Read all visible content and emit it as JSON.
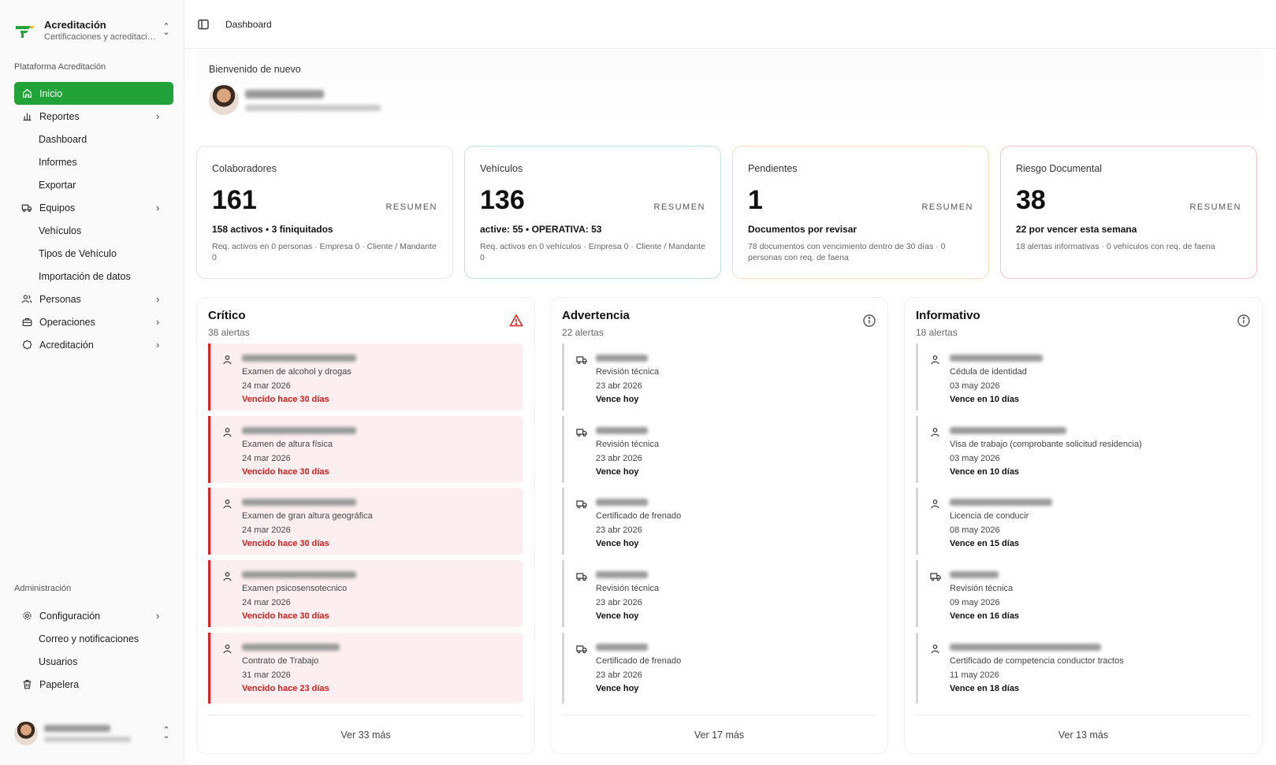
{
  "brand": {
    "title": "Acreditación",
    "subtitle": "Certificaciones y acreditaciones"
  },
  "sidebar": {
    "section_label": "Plataforma Acreditación",
    "items": [
      {
        "label": "Inicio",
        "icon": "home-icon",
        "active": true
      },
      {
        "label": "Reportes",
        "icon": "chart-icon",
        "subitems": [
          "Dashboard",
          "Informes",
          "Exportar"
        ]
      },
      {
        "label": "Equipos",
        "icon": "truck-icon",
        "subitems": [
          "Vehículos",
          "Tipos de Vehículo",
          "Importación de datos"
        ]
      },
      {
        "label": "Personas",
        "icon": "users-icon"
      },
      {
        "label": "Operaciones",
        "icon": "briefcase-icon"
      },
      {
        "label": "Acreditación",
        "icon": "badge-icon"
      }
    ],
    "admin_label": "Administración",
    "admin_items": [
      {
        "label": "Configuración",
        "icon": "gear-icon",
        "subitems": [
          "Correo y notificaciones",
          "Usuarios"
        ]
      },
      {
        "label": "Papelera",
        "icon": "trash-icon"
      }
    ]
  },
  "topbar": {
    "breadcrumb": "Dashboard"
  },
  "welcome": {
    "label": "Bienvenido de nuevo"
  },
  "stats": [
    {
      "title": "Colaboradores",
      "value": "161",
      "tag": "RESUMEN",
      "line1": "158 activos • 3 finiquitados",
      "line2": "Req. activos en 0 personas · Empresa 0 · Cliente / Mandante 0",
      "border": "#e6e6e6"
    },
    {
      "title": "Vehículos",
      "value": "136",
      "tag": "RESUMEN",
      "line1": "active: 55 • OPERATIVA: 53",
      "line2": "Req. activos en 0 vehículos · Empresa 0 · Cliente / Mandante 0",
      "border": "#bfe3de"
    },
    {
      "title": "Pendientes",
      "value": "1",
      "tag": "RESUMEN",
      "line1": "Documentos por revisar",
      "line2": "78 documentos con vencimiento dentro de 30 días · 0 personas con req. de faena",
      "border": "#f5dcc0"
    },
    {
      "title": "Riesgo Documental",
      "value": "38",
      "tag": "RESUMEN",
      "line1": "22 por vencer esta semana",
      "line2": "18 alertas informativas · 0 vehículos con req. de faena",
      "border": "#f3c4c8"
    }
  ],
  "columns": [
    {
      "title": "Crítico",
      "count": "38 alertas",
      "more": "Ver 33 más",
      "icon": "warning-triangle-icon",
      "accent": "#e02424",
      "alerts": [
        {
          "kind": "person",
          "doc": "Examen de alcohol y drogas",
          "date": "24 mar 2026",
          "status": "Vencido hace 30 días"
        },
        {
          "kind": "person",
          "doc": "Examen de altura física",
          "date": "24 mar 2026",
          "status": "Vencido hace 30 días"
        },
        {
          "kind": "person",
          "doc": "Examen de gran altura geográfica",
          "date": "24 mar 2026",
          "status": "Vencido hace 30 días"
        },
        {
          "kind": "person",
          "doc": "Examen psicosensotecnico",
          "date": "24 mar 2026",
          "status": "Vencido hace 30 días"
        },
        {
          "kind": "person",
          "doc": "Contrato de Trabajo",
          "date": "31 mar 2026",
          "status": "Vencido hace 23 días"
        }
      ]
    },
    {
      "title": "Advertencia",
      "count": "22 alertas",
      "more": "Ver 17 más",
      "icon": "info-circle-icon",
      "accent": "#555555",
      "alerts": [
        {
          "kind": "vehicle",
          "doc": "Revisión técnica",
          "date": "23 abr 2026",
          "status": "Vence hoy"
        },
        {
          "kind": "vehicle",
          "doc": "Revisión técnica",
          "date": "23 abr 2026",
          "status": "Vence hoy"
        },
        {
          "kind": "vehicle",
          "doc": "Certificado de frenado",
          "date": "23 abr 2026",
          "status": "Vence hoy"
        },
        {
          "kind": "vehicle",
          "doc": "Revisión técnica",
          "date": "23 abr 2026",
          "status": "Vence hoy"
        },
        {
          "kind": "vehicle",
          "doc": "Certificado de frenado",
          "date": "23 abr 2026",
          "status": "Vence hoy"
        }
      ]
    },
    {
      "title": "Informativo",
      "count": "18 alertas",
      "more": "Ver 13 más",
      "icon": "info-circle-icon",
      "accent": "#555555",
      "alerts": [
        {
          "kind": "person",
          "doc": "Cédula de identidad",
          "date": "03 may 2026",
          "status": "Vence en 10 días"
        },
        {
          "kind": "person",
          "doc": "Visa de trabajo (comprobante solicitud residencia)",
          "date": "03 may 2026",
          "status": "Vence en 10 días"
        },
        {
          "kind": "person",
          "doc": "Licencia de conducir",
          "date": "08 may 2026",
          "status": "Vence en 15 días"
        },
        {
          "kind": "vehicle",
          "doc": "Revisión técnica",
          "date": "09 may 2026",
          "status": "Vence en 16 días"
        },
        {
          "kind": "person",
          "doc": "Certificado de competencia conductor tractos",
          "date": "11 may 2026",
          "status": "Vence en 18 días"
        }
      ]
    }
  ]
}
